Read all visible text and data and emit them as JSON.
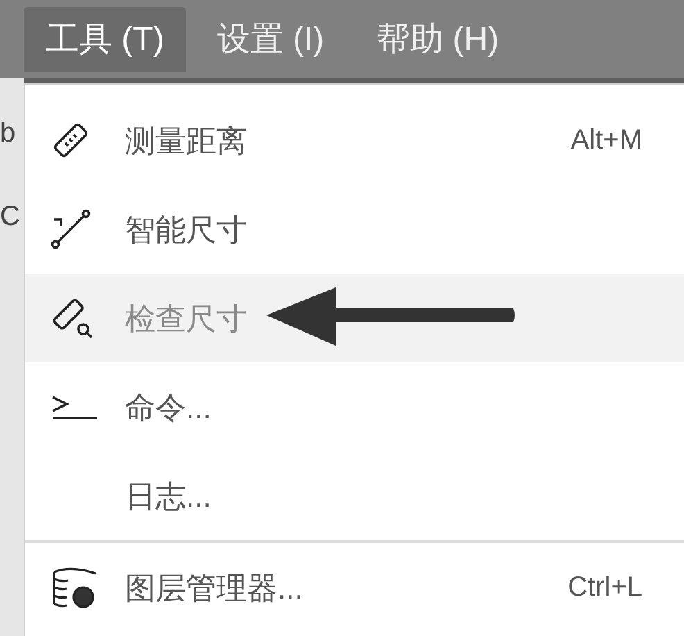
{
  "menubar": [
    {
      "label": "工具 (T)",
      "selected": true
    },
    {
      "label": "设置 (I)",
      "selected": false
    },
    {
      "label": "帮助 (H)",
      "selected": false
    }
  ],
  "background_texts": [
    "b",
    "C"
  ],
  "menu": {
    "groups": [
      [
        {
          "label": "测量距离",
          "shortcut": "Alt+M",
          "selected": false
        },
        {
          "label": "智能尺寸",
          "selected": false
        },
        {
          "label": "检查尺寸",
          "selected": true
        },
        {
          "label": "命令...",
          "selected": false
        },
        {
          "label": "日志...",
          "selected": false
        }
      ],
      [
        {
          "label": "图层管理器...",
          "shortcut": "Ctrl+L",
          "selected": false
        }
      ]
    ]
  }
}
